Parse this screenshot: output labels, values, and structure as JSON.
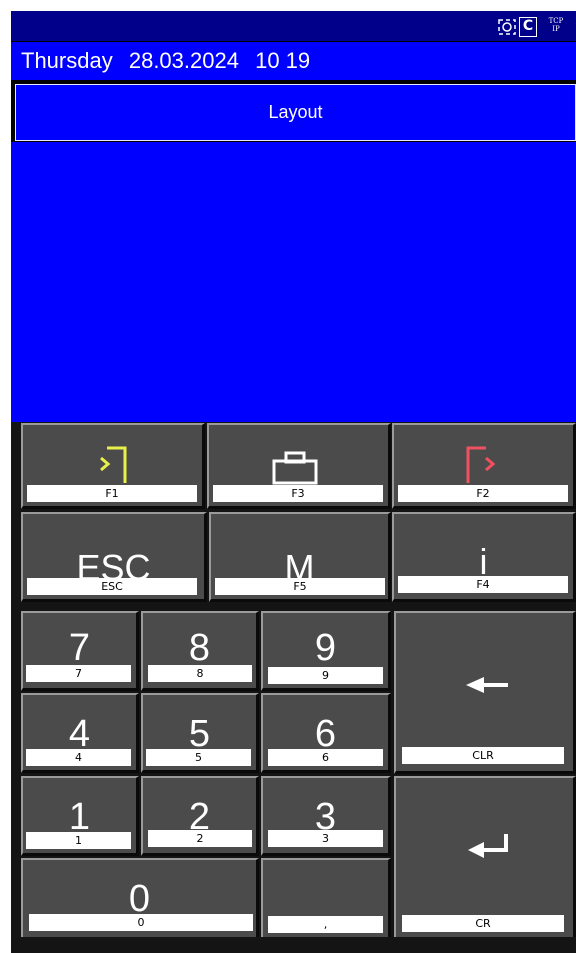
{
  "status_icons": {
    "camera_icon": "camera-icon",
    "c_indicator": "C",
    "tcp_line1": "TCP",
    "tcp_line2": "IP"
  },
  "datebar": {
    "weekday": "Thursday",
    "date": "28.03.2024",
    "time": "10 19"
  },
  "title": "Layout",
  "keys": {
    "f1": {
      "label": "F1",
      "icon": "enter-bracket-icon"
    },
    "f3": {
      "label": "F3",
      "icon": "briefcase-icon"
    },
    "f2": {
      "label": "F2",
      "icon": "exit-bracket-icon"
    },
    "esc": {
      "glyph": "ESC",
      "label": "ESC"
    },
    "m": {
      "glyph": "M",
      "label": "F5"
    },
    "i": {
      "glyph": "i",
      "label": "F4"
    },
    "k7": {
      "glyph": "7",
      "label": "7"
    },
    "k8": {
      "glyph": "8",
      "label": "8"
    },
    "k9": {
      "glyph": "9",
      "label": "9"
    },
    "clr": {
      "label": "CLR",
      "icon": "left-arrow-icon"
    },
    "k4": {
      "glyph": "4",
      "label": "4"
    },
    "k5": {
      "glyph": "5",
      "label": "5"
    },
    "k6": {
      "glyph": "6",
      "label": "6"
    },
    "k1": {
      "glyph": "1",
      "label": "1"
    },
    "k2": {
      "glyph": "2",
      "label": "2"
    },
    "k3": {
      "glyph": "3",
      "label": "3"
    },
    "cr": {
      "label": "CR",
      "icon": "return-arrow-icon"
    },
    "k0": {
      "glyph": "0",
      "label": "0"
    },
    "comma": {
      "glyph": ",",
      "label": ","
    }
  },
  "colors": {
    "topbar": "#00008a",
    "blue": "#0000ff",
    "key_face": "#4b4b4b",
    "f1_accent": "#e8f04a",
    "f2_accent": "#f05060"
  }
}
